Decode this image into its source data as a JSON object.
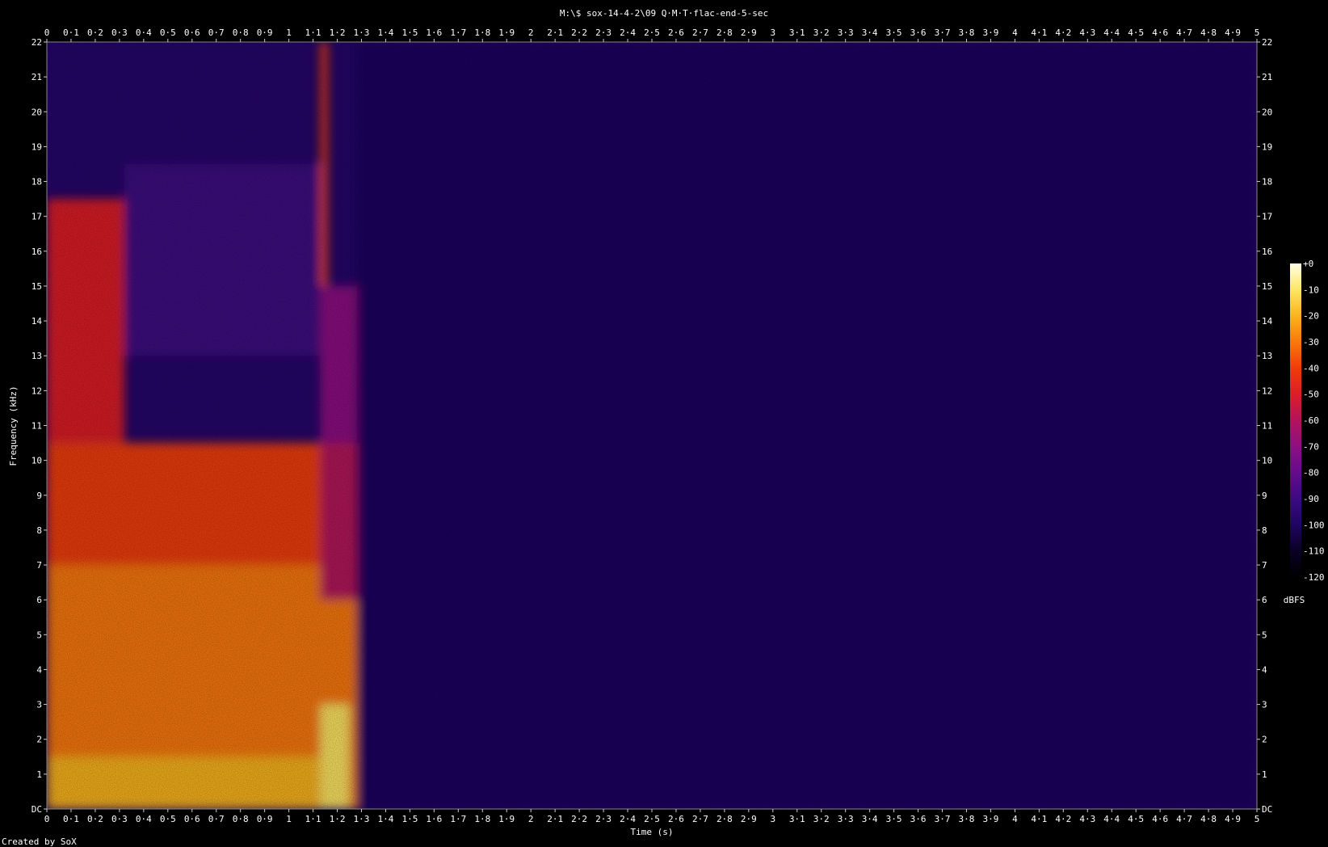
{
  "chart_data": {
    "type": "heatmap",
    "title": "M:\\$ sox-14-4-2\\09 Q·M·T·flac-end-5-sec",
    "xlabel": "Time (s)",
    "ylabel": "Frequency (kHz)",
    "footer": "Created by SoX",
    "xlim": [
      0,
      5
    ],
    "ylim": [
      0,
      22
    ],
    "x_ticks": [
      0,
      0.1,
      0.2,
      0.3,
      0.4,
      0.5,
      0.6,
      0.7,
      0.8,
      0.9,
      1,
      1.1,
      1.2,
      1.3,
      1.4,
      1.5,
      1.6,
      1.7,
      1.8,
      1.9,
      2,
      2.1,
      2.2,
      2.3,
      2.4,
      2.5,
      2.6,
      2.7,
      2.8,
      2.9,
      3,
      3.1,
      3.2,
      3.3,
      3.4,
      3.5,
      3.6,
      3.7,
      3.8,
      3.9,
      4,
      4.1,
      4.2,
      4.3,
      4.4,
      4.5,
      4.6,
      4.7,
      4.8,
      4.9,
      5
    ],
    "x_tick_labels": [
      "0",
      "0·1",
      "0·2",
      "0·3",
      "0·4",
      "0·5",
      "0·6",
      "0·7",
      "0·8",
      "0·9",
      "1",
      "1·1",
      "1·2",
      "1·3",
      "1·4",
      "1·5",
      "1·6",
      "1·7",
      "1·8",
      "1·9",
      "2",
      "2·1",
      "2·2",
      "2·3",
      "2·4",
      "2·5",
      "2·6",
      "2·7",
      "2·8",
      "2·9",
      "3",
      "3·1",
      "3·2",
      "3·3",
      "3·4",
      "3·5",
      "3·6",
      "3·7",
      "3·8",
      "3·9",
      "4",
      "4·1",
      "4·2",
      "4·3",
      "4·4",
      "4·5",
      "4·6",
      "4·7",
      "4·8",
      "4·9",
      "5"
    ],
    "y_ticks": [
      0,
      1,
      2,
      3,
      4,
      5,
      6,
      7,
      8,
      9,
      10,
      11,
      12,
      13,
      14,
      15,
      16,
      17,
      18,
      19,
      20,
      21,
      22
    ],
    "y_tick_labels": [
      "DC",
      "1",
      "2",
      "3",
      "4",
      "5",
      "6",
      "7",
      "8",
      "9",
      "10",
      "11",
      "12",
      "13",
      "14",
      "15",
      "16",
      "17",
      "18",
      "19",
      "20",
      "21",
      "22"
    ],
    "colorbar": {
      "label": "dBFS",
      "range": [
        -120,
        0
      ],
      "ticks": [
        0,
        -10,
        -20,
        -30,
        -40,
        -50,
        -60,
        -70,
        -80,
        -90,
        -100,
        -110,
        -120
      ],
      "tick_labels": [
        "+0",
        "-10",
        "-20",
        "-30",
        "-40",
        "-50",
        "-60",
        "-70",
        "-80",
        "-90",
        "-100",
        "-110",
        "-120"
      ],
      "colors": [
        "#000000",
        "#0a0026",
        "#1e0560",
        "#3c0a82",
        "#640c8c",
        "#8c1082",
        "#b4125a",
        "#dc1e28",
        "#f03c0a",
        "#fa780a",
        "#fab41e",
        "#ffe664",
        "#ffffe6"
      ]
    },
    "regions": [
      {
        "t": [
          0.0,
          1.13
        ],
        "f": [
          0,
          10.5
        ],
        "dbfs": -40
      },
      {
        "t": [
          0.0,
          0.32
        ],
        "f": [
          10.5,
          17.5
        ],
        "dbfs": -55
      },
      {
        "t": [
          0.32,
          1.13
        ],
        "f": [
          13,
          18.5
        ],
        "dbfs": -92
      },
      {
        "t": [
          0.0,
          1.13
        ],
        "f": [
          0,
          7
        ],
        "dbfs": -30
      },
      {
        "t": [
          0.0,
          1.13
        ],
        "f": [
          0,
          1.5
        ],
        "dbfs": -18
      },
      {
        "t": [
          1.13,
          1.16
        ],
        "f": [
          0,
          22
        ],
        "dbfs": -45
      },
      {
        "t": [
          1.13,
          1.3
        ],
        "f": [
          10.5,
          15
        ],
        "dbfs": -75
      },
      {
        "t": [
          1.13,
          2.4
        ],
        "f": [
          0,
          10.5
        ],
        "dbfs": -60
      },
      {
        "t": [
          1.13,
          1.6
        ],
        "f": [
          0,
          6
        ],
        "dbfs": -30
      },
      {
        "t": [
          1.13,
          1.25
        ],
        "f": [
          0,
          3
        ],
        "dbfs": -15
      },
      {
        "t": [
          1.28,
          5.0
        ],
        "f": [
          0,
          10.5
        ],
        "dbfs": -102
      },
      {
        "t": [
          1.28,
          5.0
        ],
        "f": [
          10.5,
          22
        ],
        "dbfs": -105
      },
      {
        "t": [
          1.28,
          5.0
        ],
        "f": [
          18,
          22
        ],
        "dbfs": -96
      }
    ]
  }
}
